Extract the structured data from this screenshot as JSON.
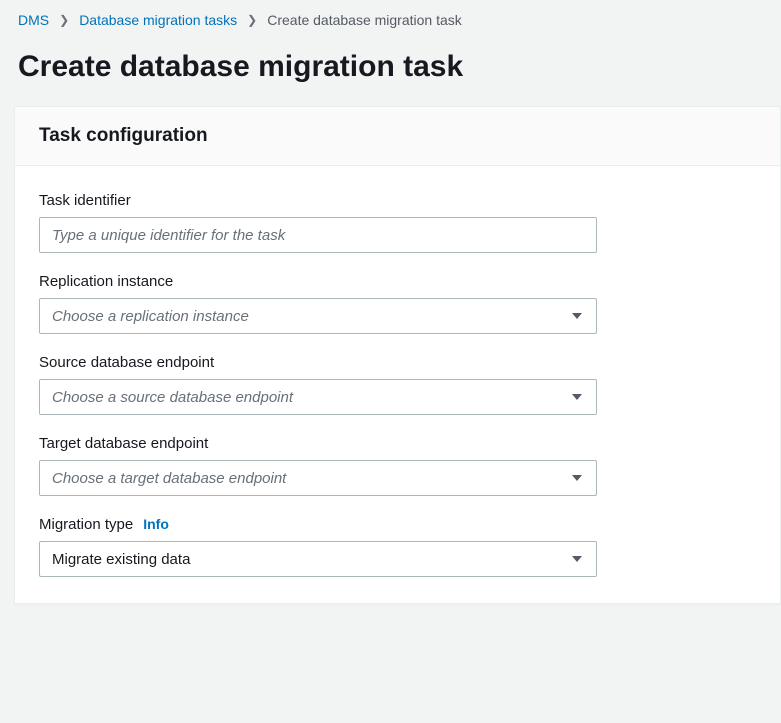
{
  "breadcrumb": {
    "items": [
      {
        "label": "DMS"
      },
      {
        "label": "Database migration tasks"
      }
    ],
    "current": "Create database migration task"
  },
  "page_title": "Create database migration task",
  "panel": {
    "title": "Task configuration"
  },
  "fields": {
    "task_identifier": {
      "label": "Task identifier",
      "placeholder": "Type a unique identifier for the task",
      "value": ""
    },
    "replication_instance": {
      "label": "Replication instance",
      "placeholder": "Choose a replication instance",
      "value": ""
    },
    "source_endpoint": {
      "label": "Source database endpoint",
      "placeholder": "Choose a source database endpoint",
      "value": ""
    },
    "target_endpoint": {
      "label": "Target database endpoint",
      "placeholder": "Choose a target database endpoint",
      "value": ""
    },
    "migration_type": {
      "label": "Migration type",
      "info": "Info",
      "value": "Migrate existing data"
    }
  }
}
